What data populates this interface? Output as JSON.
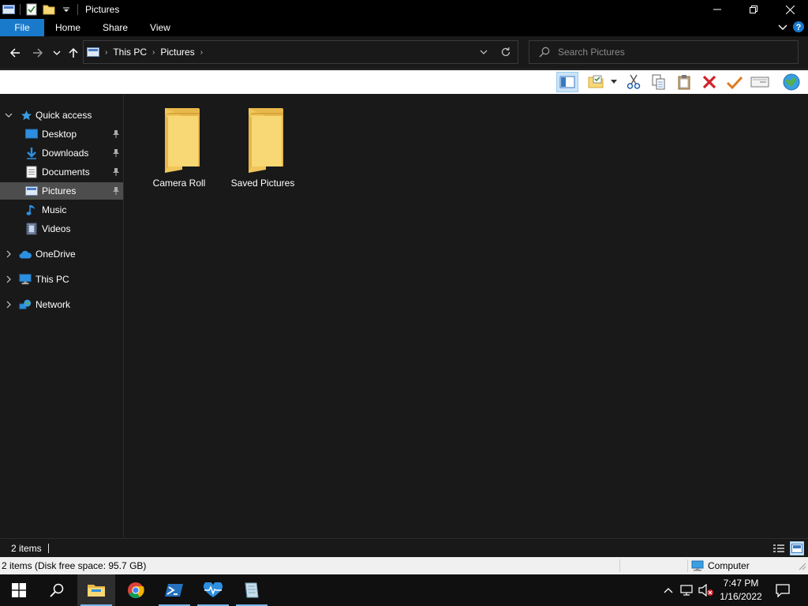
{
  "window": {
    "title": "Pictures",
    "controls": {
      "minimize": "─",
      "restore": "❐",
      "close": "✕"
    }
  },
  "ribbon": {
    "tabs": [
      {
        "label": "File"
      },
      {
        "label": "Home"
      },
      {
        "label": "Share"
      },
      {
        "label": "View"
      }
    ]
  },
  "address": {
    "breadcrumbs": [
      {
        "label": "This PC"
      },
      {
        "label": "Pictures"
      }
    ],
    "search_placeholder": "Search Pictures"
  },
  "navigation": {
    "quick_access": {
      "label": "Quick access",
      "items": [
        {
          "label": "Desktop",
          "icon": "desktop-icon",
          "pinned": true
        },
        {
          "label": "Downloads",
          "icon": "downloads-icon",
          "pinned": true
        },
        {
          "label": "Documents",
          "icon": "documents-icon",
          "pinned": true
        },
        {
          "label": "Pictures",
          "icon": "pictures-icon",
          "pinned": true,
          "selected": true
        },
        {
          "label": "Music",
          "icon": "music-icon",
          "pinned": false
        },
        {
          "label": "Videos",
          "icon": "videos-icon",
          "pinned": false
        }
      ]
    },
    "roots": [
      {
        "label": "OneDrive",
        "icon": "onedrive-icon"
      },
      {
        "label": "This PC",
        "icon": "this-pc-icon"
      },
      {
        "label": "Network",
        "icon": "network-icon"
      }
    ]
  },
  "content": {
    "folders": [
      {
        "name": "Camera Roll"
      },
      {
        "name": "Saved Pictures"
      }
    ]
  },
  "status": {
    "item_count": "2 items",
    "classic_text": "2 items (Disk free space: 95.7 GB)",
    "zone": "Computer"
  },
  "taskbar": {
    "apps": [
      {
        "name": "File Explorer",
        "icon": "file-explorer-icon",
        "active": true
      },
      {
        "name": "Google Chrome",
        "icon": "chrome-icon"
      },
      {
        "name": "PowerShell",
        "icon": "powershell-icon"
      },
      {
        "name": "Health Monitor",
        "icon": "heartbeat-icon"
      },
      {
        "name": "Notepad Document",
        "icon": "document-app-icon"
      }
    ],
    "time": "7:47 PM",
    "date": "1/16/2022"
  },
  "colors": {
    "accent": "#1979ca",
    "folder": "#f8d775",
    "background": "#191919"
  }
}
